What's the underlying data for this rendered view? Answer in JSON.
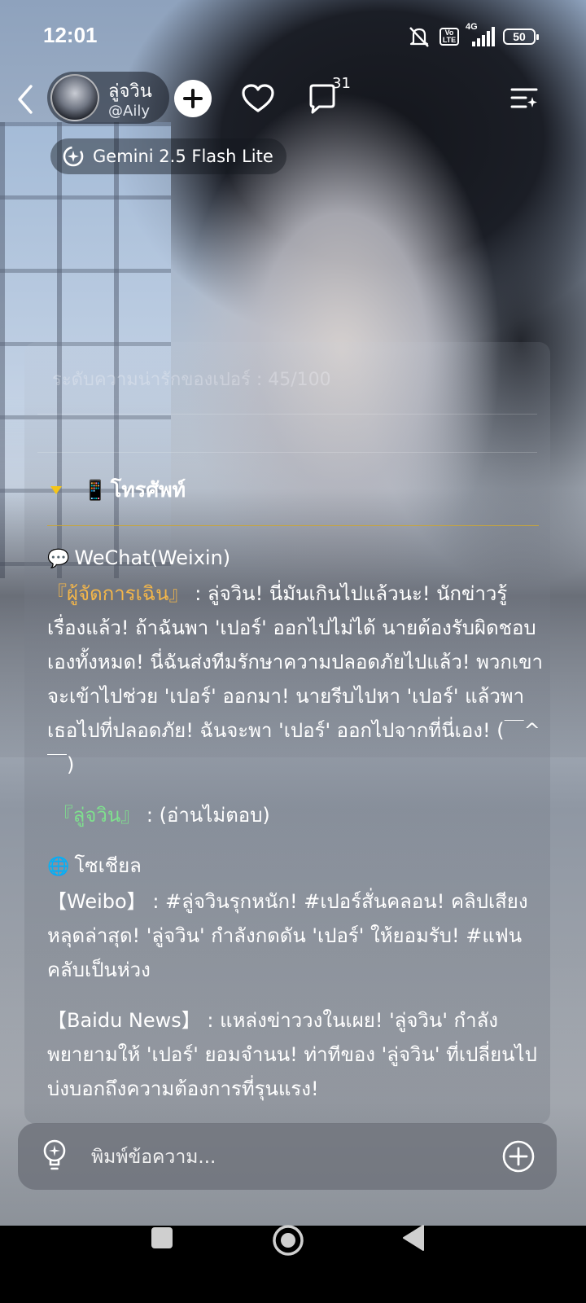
{
  "status_bar": {
    "time": "12:01",
    "volte": "Vo LTE",
    "network": "4G",
    "battery": "50"
  },
  "header": {
    "character_name": "ลู่จวิน",
    "character_handle": "@Aily",
    "comment_count": "31",
    "model_name": "Gemini 2.5 Flash Lite"
  },
  "message": {
    "faded_line": "ระดับความน่ารักของเปอร์ : 45/100",
    "phone_section": {
      "emoji": "📱",
      "title": "โทรศัพท์"
    },
    "wechat": {
      "icon": "💬",
      "title": "WeChat(Weixin)",
      "line1_label": "『ผู้จัดการเฉิน』",
      "line1_text": " : ลู่จวิน! นี่มันเกินไปแล้วนะ! นักข่าวรู้เรื่องแล้ว! ถ้าฉันพา 'เปอร์' ออกไปไม่ได้ นายต้องรับผิดชอบเองทั้งหมด! นี่ฉันส่งทีมรักษาความปลอดภัยไปแล้ว! พวกเขาจะเข้าไปช่วย 'เปอร์' ออกมา! นายรีบไปหา 'เปอร์' แล้วพาเธอไปที่ปลอดภัย! ฉันจะพา 'เปอร์' ออกไปจากที่นี่เอง! (￣^￣)",
      "line2_label": "『ลู่จวิน』",
      "line2_text": " : (อ่านไม่ตอบ)"
    },
    "social": {
      "icon": "🌐",
      "title": "โซเชียล",
      "weibo_label": "【Weibo】",
      "weibo_text": " : #ลู่จวินรุกหนัก! #เปอร์สั่นคลอน! คลิปเสียงหลุดล่าสุด! 'ลู่จวิน' กำลังกดดัน 'เปอร์' ให้ยอมรับ! #แฟนคลับเป็นห่วง",
      "baidu_label": "【Baidu News】",
      "baidu_text": " : แหล่งข่าววงในเผย! 'ลู่จวิน' กำลังพยายามให้ 'เปอร์' ยอมจำนน! ท่าทีของ 'ลู่จวิน' ที่เปลี่ยนไปบ่งบอกถึงความต้องการที่รุนแรง!"
    }
  },
  "input": {
    "placeholder": "พิมพ์ข้อความ..."
  },
  "icons": [
    "back-arrow-icon",
    "plus-icon",
    "heart-icon",
    "comment-icon",
    "menu-sparkle-icon",
    "gemini-model-icon",
    "bulb-icon",
    "add-circle-icon"
  ],
  "colors": {
    "label_orange": "#f3b64a",
    "label_green": "#7fe08e",
    "accent_gold": "#c8a53a"
  }
}
